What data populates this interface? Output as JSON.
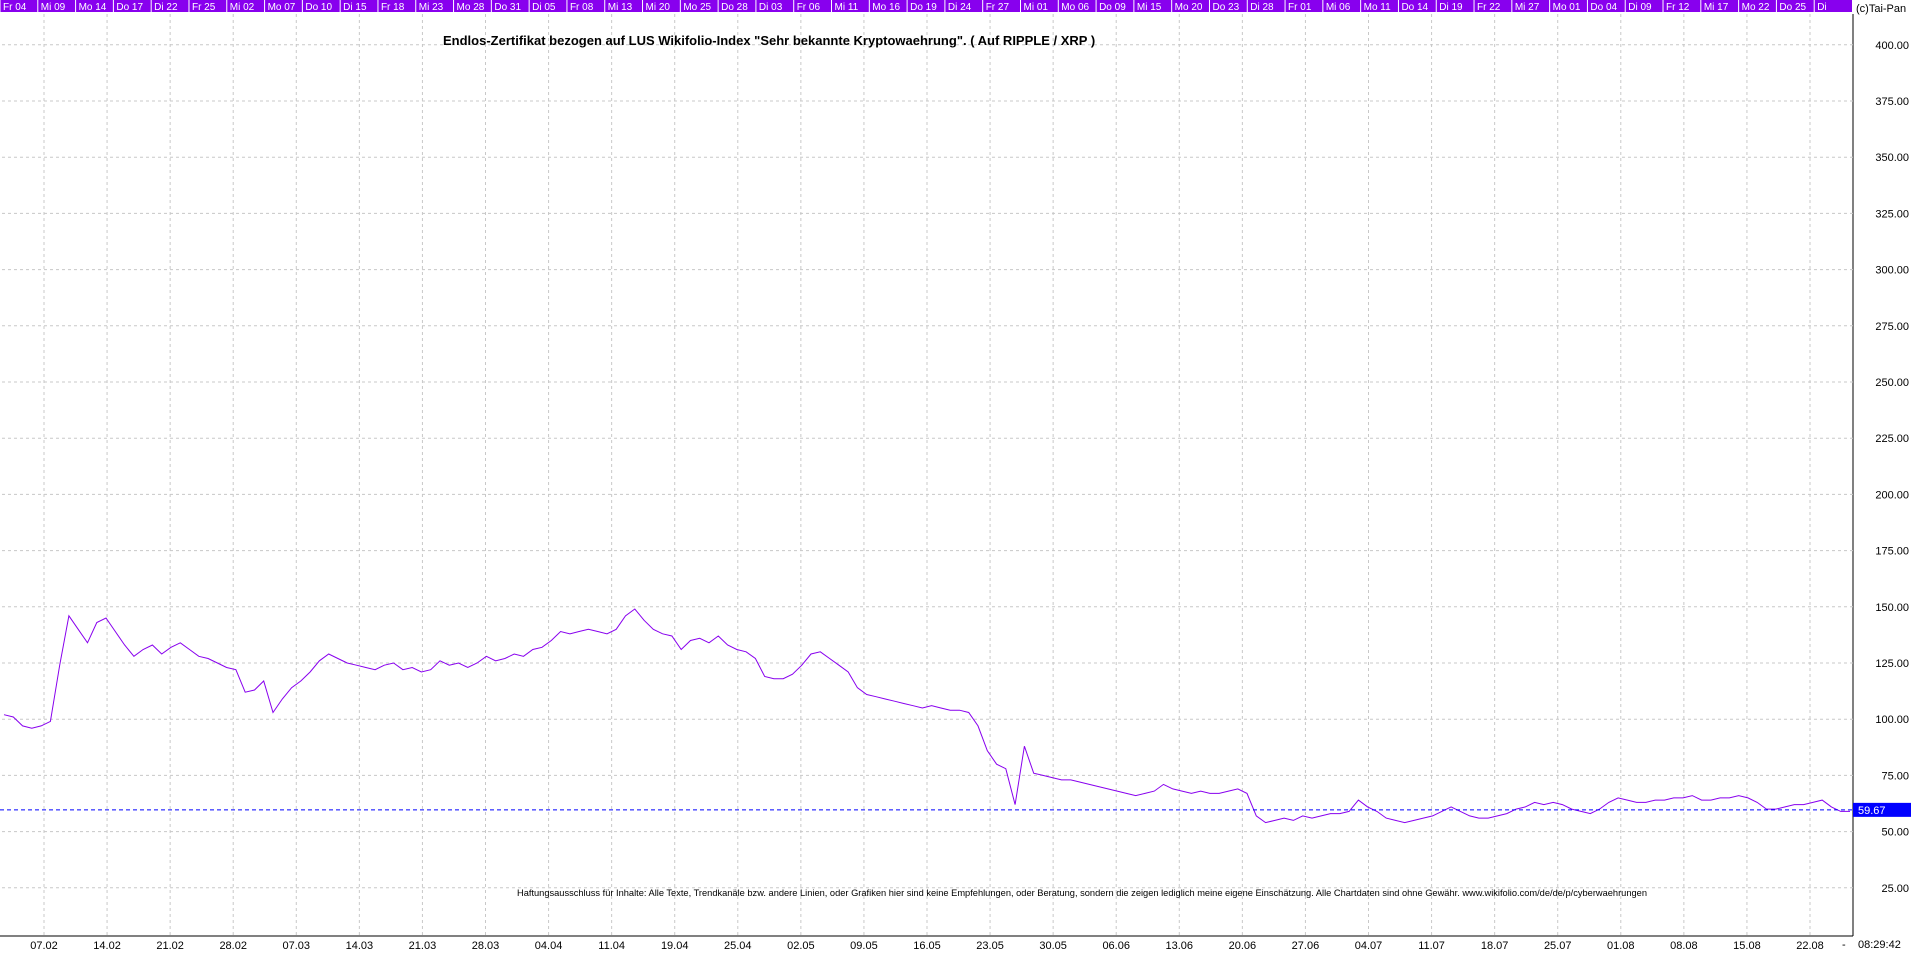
{
  "header": {
    "day_labels": [
      "Fr 04",
      "Mi 09",
      "Mo 14",
      "Do 17",
      "Di 22",
      "Fr 25",
      "Mi 02",
      "Mo 07",
      "Do 10",
      "Di 15",
      "Fr 18",
      "Mi 23",
      "Mo 28",
      "Do 31",
      "Di 05",
      "Fr 08",
      "Mi 13",
      "Mi 20",
      "Mo 25",
      "Do 28",
      "Di 03",
      "Fr 06",
      "Mi 11",
      "Mo 16",
      "Do 19",
      "Di 24",
      "Fr 27",
      "Mi 01",
      "Mo 06",
      "Do 09",
      "Mi 15",
      "Mo 20",
      "Do 23",
      "Di 28",
      "Fr 01",
      "Mi 06",
      "Mo 11",
      "Do 14",
      "Di 19",
      "Fr 22",
      "Mi 27",
      "Mo 01",
      "Do 04",
      "Di 09",
      "Fr 12",
      "Mi 17",
      "Mo 22",
      "Do 25",
      "Di"
    ],
    "copyright": "(c)Tai-Pan"
  },
  "footer": {
    "time": "08:29:42",
    "dash": "-"
  },
  "colors": {
    "line": "#8800ee",
    "header_bg": "#8800ee",
    "header_text": "#ffffff",
    "current_line": "#0000ff",
    "current_box": "#0000ff",
    "grid": "#c8c8c8"
  },
  "chart_data": {
    "type": "line",
    "title": "Endlos-Zertifikat bezogen auf LUS Wikifolio-Index \"Sehr bekannte Kryptowaehrung\". ( Auf RIPPLE / XRP )",
    "subtitle": "Haftungsausschluss für Inhalte: Alle Texte, Trendkanäle bzw. andere Linien, oder Grafiken hier sind keine Empfehlungen, oder Beratung, sondern die zeigen lediglich meine eigene Einschätzung. Alle Chartdaten sind ohne Gewähr. www.wikifolio.com/de/de/p/cyberwaehrungen",
    "xlabel": "",
    "ylabel": "",
    "ylim": [
      0,
      400
    ],
    "y_ticks": [
      "25.00",
      "50.00",
      "75.00",
      "100.00",
      "125.00",
      "150.00",
      "175.00",
      "200.00",
      "225.00",
      "250.00",
      "275.00",
      "300.00",
      "325.00",
      "350.00",
      "375.00",
      "400.00"
    ],
    "x_tick_labels": [
      "07.02",
      "14.02",
      "21.02",
      "28.02",
      "07.03",
      "14.03",
      "21.03",
      "28.03",
      "04.04",
      "11.04",
      "19.04",
      "25.04",
      "02.05",
      "09.05",
      "16.05",
      "23.05",
      "30.05",
      "06.06",
      "13.06",
      "20.06",
      "27.06",
      "04.07",
      "11.07",
      "18.07",
      "25.07",
      "01.08",
      "08.08",
      "15.08",
      "22.08"
    ],
    "grid": true,
    "current_value": "59.67",
    "series": [
      {
        "values": [
          102,
          101,
          97,
          96,
          97,
          99,
          124,
          146,
          140,
          134,
          143,
          145,
          139,
          133,
          128,
          131,
          133,
          129,
          132,
          134,
          131,
          128,
          127,
          125,
          123,
          122,
          112,
          113,
          117,
          103,
          109,
          114,
          117,
          121,
          126,
          129,
          127,
          125,
          124,
          123,
          122,
          124,
          125,
          122,
          123,
          121,
          122,
          126,
          124,
          125,
          123,
          125,
          128,
          126,
          127,
          129,
          128,
          131,
          132,
          135,
          139,
          138,
          139,
          140,
          139,
          138,
          140,
          146,
          149,
          144,
          140,
          138,
          137,
          131,
          135,
          136,
          134,
          137,
          133,
          131,
          130,
          127,
          119,
          118,
          118,
          120,
          124,
          129,
          130,
          127,
          124,
          121,
          114,
          111,
          110,
          109,
          108,
          107,
          106,
          105,
          106,
          105,
          104,
          104,
          103,
          97,
          86,
          80,
          78,
          62,
          88,
          76,
          75,
          74,
          73,
          73,
          72,
          71,
          70,
          69,
          68,
          67,
          66,
          67,
          68,
          71,
          69,
          68,
          67,
          68,
          67,
          67,
          68,
          69,
          67,
          57,
          54,
          55,
          56,
          55,
          57,
          56,
          57,
          58,
          58,
          59,
          64,
          61,
          59,
          56,
          55,
          54,
          55,
          56,
          57,
          59,
          61,
          59,
          57,
          56,
          56,
          57,
          58,
          60,
          61,
          63,
          62,
          63,
          62,
          60,
          59,
          58,
          60,
          63,
          65,
          64,
          63,
          63,
          64,
          64,
          65,
          65,
          66,
          64,
          64,
          65,
          65,
          66,
          65,
          63,
          60,
          60,
          61,
          62,
          62,
          63,
          64,
          61,
          59,
          59
        ]
      }
    ]
  }
}
